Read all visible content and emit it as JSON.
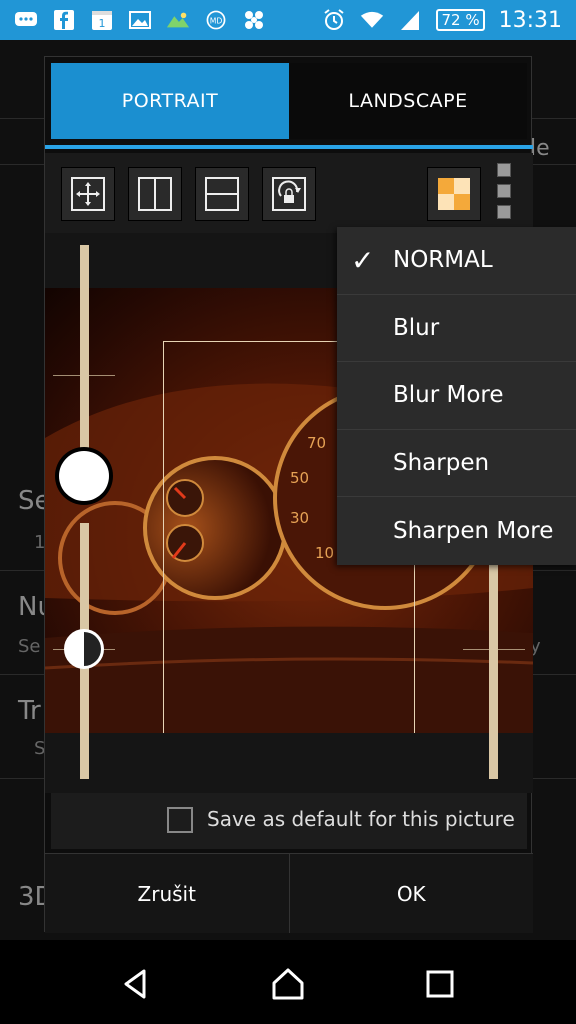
{
  "status_bar": {
    "battery": "72 %",
    "time": "13:31",
    "notification_icons": [
      "chat-icon",
      "facebook-icon",
      "calendar-icon",
      "image-icon",
      "landscape-icon",
      "md-icon",
      "fan-icon"
    ],
    "calendar_day": "1"
  },
  "dialog": {
    "tabs": [
      {
        "label": "PORTRAIT",
        "active": true
      },
      {
        "label": "LANDSCAPE",
        "active": false
      }
    ],
    "toolbar": {
      "tools": [
        "fit-screen-icon",
        "split-vertical-icon",
        "split-horizontal-icon",
        "rotate-lock-icon"
      ],
      "filter_icon": "checkerboard-icon"
    },
    "save_default_label": "Save as default for this picture",
    "save_default_checked": false,
    "cancel_label": "Zrušit",
    "ok_label": "OK"
  },
  "menu": {
    "items": [
      {
        "label": "NORMAL",
        "checked": true
      },
      {
        "label": "Blur",
        "checked": false
      },
      {
        "label": "Blur More",
        "checked": false
      },
      {
        "label": "Sharpen",
        "checked": false
      },
      {
        "label": "Sharpen More",
        "checked": false
      }
    ]
  },
  "background": {
    "items": [
      "Se",
      "1",
      "Nu",
      "Se",
      "y",
      "Tr",
      "S",
      "3D",
      "le"
    ]
  },
  "colors": {
    "status_bar": "#2196d6",
    "accent": "#1b8fd0",
    "menu_bg": "#2b2b2b"
  }
}
